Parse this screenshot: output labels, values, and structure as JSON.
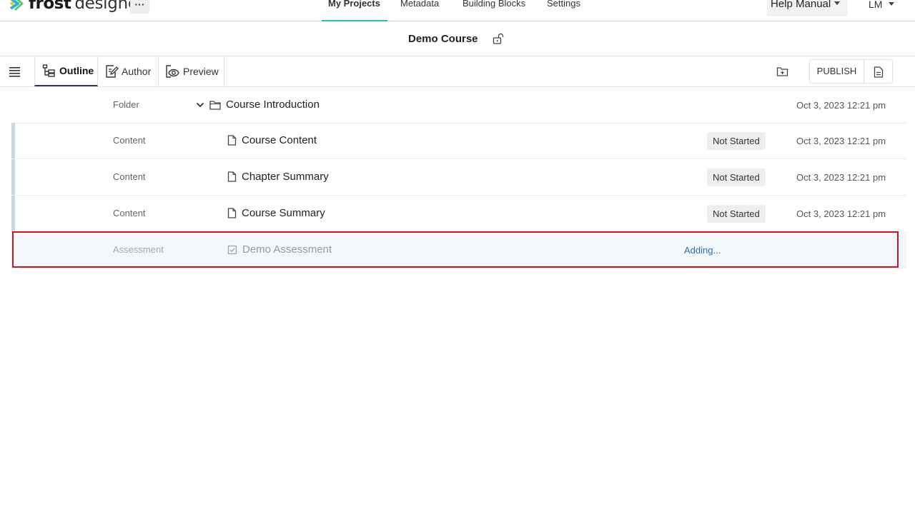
{
  "brand": {
    "name_bold": "frost",
    "name_light": "designer",
    "colors": {
      "mark_teal": "#2bb5c8",
      "mark_yellow": "#f5c518",
      "mark_green": "#4cbf6a"
    }
  },
  "topnav": {
    "more_label": "···",
    "items": [
      {
        "label": "My Projects",
        "active": true
      },
      {
        "label": "Metadata",
        "active": false
      },
      {
        "label": "Building Blocks",
        "active": false
      },
      {
        "label": "Settings",
        "active": false
      }
    ],
    "help_label": "Help Manual",
    "user_label": "LM"
  },
  "course": {
    "title": "Demo Course",
    "lock_icon": "unlock-icon"
  },
  "toolbar": {
    "tabs": [
      {
        "label": "Outline",
        "icon": "outline-tree-icon",
        "active": true
      },
      {
        "label": "Author",
        "icon": "author-edit-icon",
        "active": false
      },
      {
        "label": "Preview",
        "icon": "preview-eye-icon",
        "active": false
      }
    ],
    "publish_label": "PUBLISH",
    "accent": "#2b3a55"
  },
  "outline": {
    "rows": [
      {
        "type": "Folder",
        "title": "Course Introduction",
        "status": "",
        "date": "Oct 3, 2023 12:21 pm",
        "icon": "folder-icon"
      },
      {
        "type": "Content",
        "title": "Course Content",
        "status": "Not Started",
        "date": "Oct 3, 2023 12:21 pm",
        "icon": "page-icon"
      },
      {
        "type": "Content",
        "title": "Chapter Summary",
        "status": "Not Started",
        "date": "Oct 3, 2023 12:21 pm",
        "icon": "page-icon"
      },
      {
        "type": "Content",
        "title": "Course Summary",
        "status": "Not Started",
        "date": "Oct 3, 2023 12:21 pm",
        "icon": "page-icon"
      },
      {
        "type": "Assessment",
        "title": "Demo Assessment",
        "status": "Adding...",
        "date": "",
        "icon": "assessment-check-icon"
      }
    ],
    "highlight_color": "#d0141e"
  }
}
